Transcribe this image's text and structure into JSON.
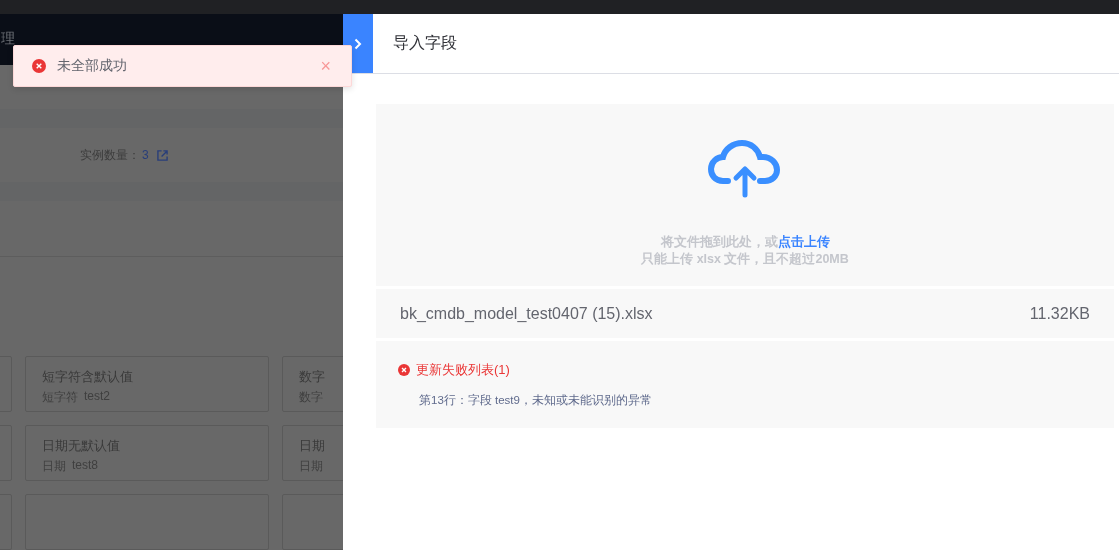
{
  "background_page": {
    "header_text": "理",
    "instance_count": {
      "label": "实例数量：",
      "value": "3"
    },
    "card_rows": [
      [
        {
          "title": "短字符含默认值",
          "type": "短字符",
          "field_id": "test2"
        },
        {
          "title": "数字",
          "type": "数字"
        }
      ],
      [
        {
          "title": "日期无默认值",
          "type": "日期",
          "field_id": "test8"
        },
        {
          "title": "日期",
          "type": "日期"
        }
      ]
    ]
  },
  "toast": {
    "message": "未全部成功",
    "close": "×"
  },
  "drawer": {
    "title": "导入字段",
    "upload": {
      "hint": "将文件拖到此处，或",
      "link": "点击上传",
      "note": "只能上传 xlsx 文件，且不超过20MB"
    },
    "file": {
      "name": "bk_cmdb_model_test0407 (15).xlsx",
      "size": "11.32KB"
    },
    "failures": {
      "title": "更新失败列表(1)",
      "items": [
        "第13行：字段 test9，未知或未能识别的异常"
      ]
    }
  }
}
